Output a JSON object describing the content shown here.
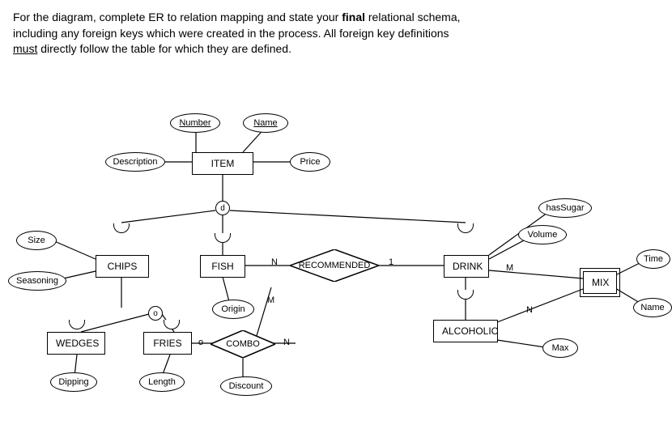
{
  "prompt": {
    "line1a": "For the diagram, complete ER to relation mapping and state your ",
    "final": "final",
    "line1b": " relational schema,",
    "line2": "including any foreign keys which were created in the process. All foreign key definitions",
    "must": "must",
    "line3": " directly follow the table for which they are defined."
  },
  "entities": {
    "item": "ITEM",
    "chips": "CHIPS",
    "fish": "FISH",
    "drink": "DRINK",
    "alcoholic": "ALCOHOLIC",
    "wedges": "WEDGES",
    "fries": "FRIES",
    "mix": "MIX"
  },
  "relationships": {
    "recommended": "RECOMMENDED",
    "combo": "COMBO"
  },
  "attributes": {
    "number": "Number",
    "name": "Name",
    "description": "Description",
    "price": "Price",
    "size": "Size",
    "seasoning": "Seasoning",
    "origin": "Origin",
    "hasSugar": "hasSugar",
    "volume": "Volume",
    "time": "Time",
    "mixName": "Name",
    "max": "Max",
    "dipping": "Dipping",
    "length": "Length",
    "discount": "Discount"
  },
  "cardinalities": {
    "recN": "N",
    "rec1": "1",
    "comboO": "o",
    "comboN": "N",
    "comboM": "M",
    "mixM": "M",
    "mixN": "N",
    "chipsO": "o"
  },
  "disjoint": "d"
}
